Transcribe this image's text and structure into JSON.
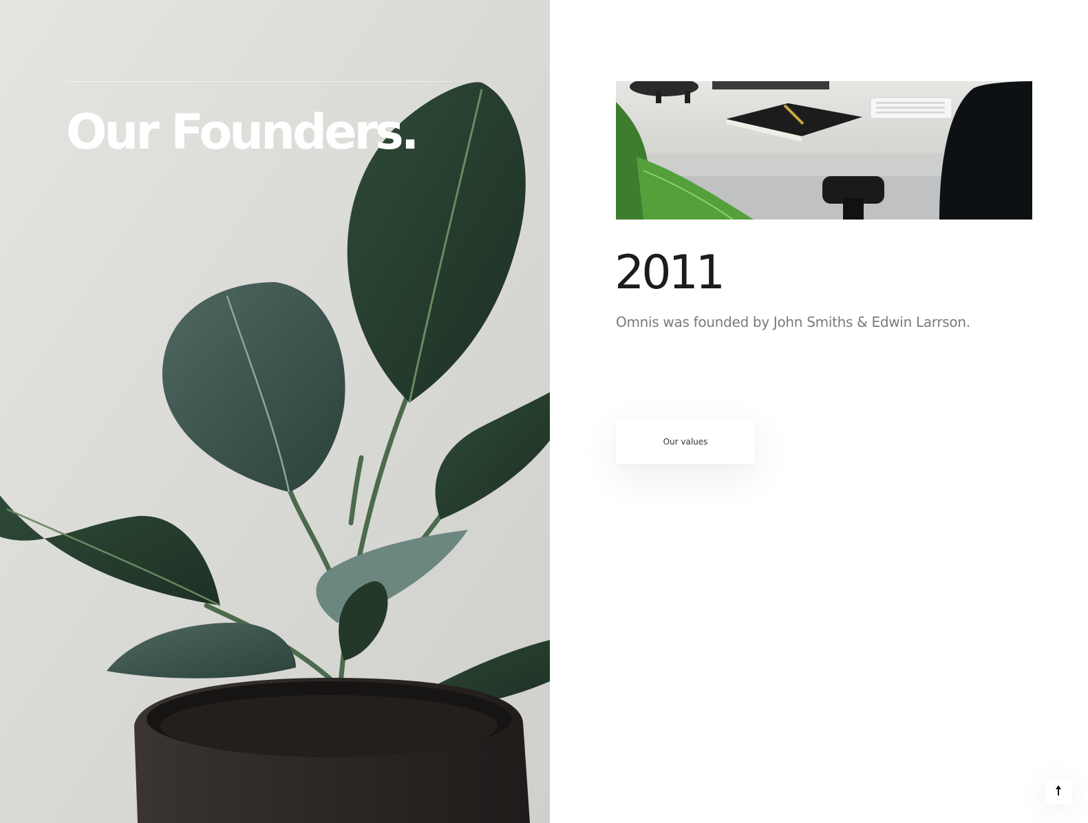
{
  "hero": {
    "title": "Our Founders.",
    "image_icon": "plant-photo"
  },
  "timeline": {
    "image_icon": "office-desk-photo",
    "year": "2011",
    "description": "Omnis was founded by John Smiths & Edwin Larrson."
  },
  "cta": {
    "label": "Our values"
  },
  "back_to_top": {
    "icon": "arrow-up-icon"
  },
  "colors": {
    "title_white": "#ffffff",
    "year_dark": "#1c1c1c",
    "description_gray": "#7a7a7a",
    "plant_leaf": "#263a2e",
    "pot": "#2b2725"
  }
}
